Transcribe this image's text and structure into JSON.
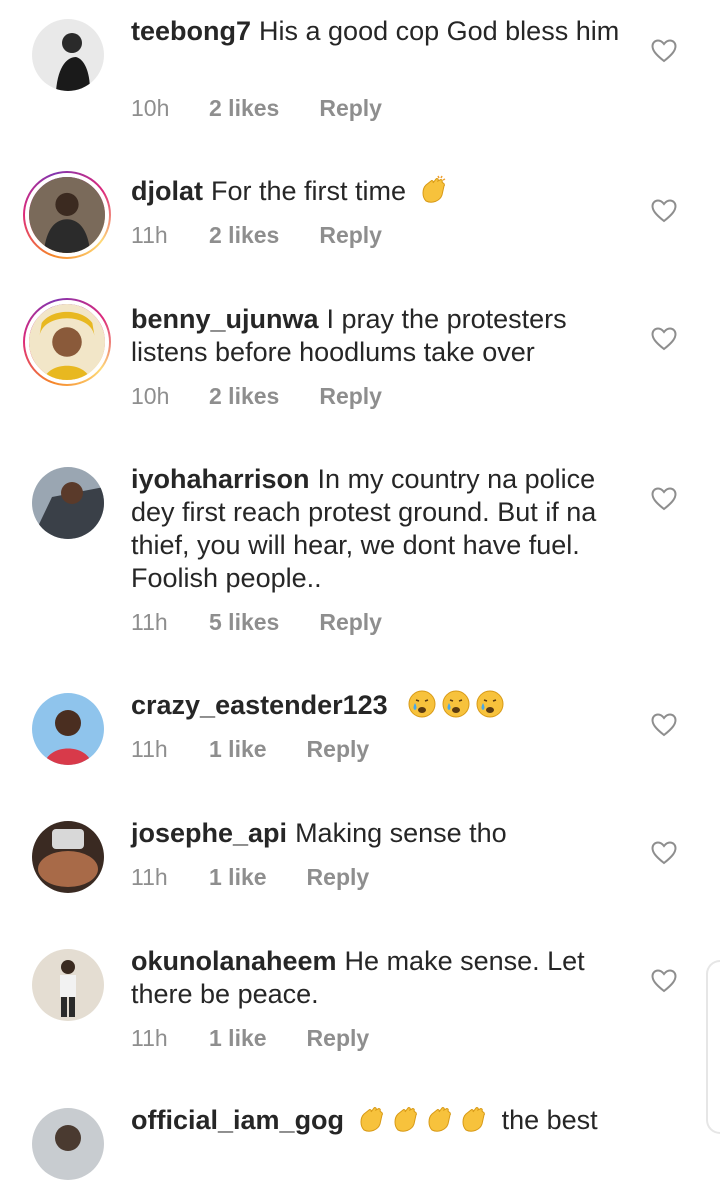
{
  "comments": [
    {
      "username": "teebong7",
      "text": "His a good cop God bless him",
      "time": "10h",
      "likes": "2 likes",
      "reply": "Reply"
    },
    {
      "username": "djolat",
      "text": "For the first time",
      "emoji": "clapping-hands-emoji",
      "time": "11h",
      "likes": "2 likes",
      "reply": "Reply"
    },
    {
      "username": "benny_ujunwa",
      "text": "I pray the protesters listens before hoodlums take over",
      "time": "10h",
      "likes": "2 likes",
      "reply": "Reply"
    },
    {
      "username": "iyohaharrison",
      "text": "In my country na police dey first reach protest ground. But if na thief, you will hear, we dont have fuel. Foolish people..",
      "time": "11h",
      "likes": "5 likes",
      "reply": "Reply"
    },
    {
      "username": "crazy_eastender123",
      "text": "",
      "emoji": "crying-face-emoji x3",
      "time": "11h",
      "likes": "1 like",
      "reply": "Reply"
    },
    {
      "username": "josephe_api",
      "text": "Making sense tho",
      "time": "11h",
      "likes": "1 like",
      "reply": "Reply"
    },
    {
      "username": "okunolanaheem",
      "text": "He make sense. Let there be peace.",
      "time": "11h",
      "likes": "1 like",
      "reply": "Reply"
    },
    {
      "username": "official_iam_gog",
      "text": "the best",
      "emoji": "clapping-hands-emoji x4"
    }
  ],
  "colors": {
    "text": "#262626",
    "meta": "#8e8e8e",
    "heart": "#8e8e8e",
    "story_ring": "#dd2a7b"
  }
}
